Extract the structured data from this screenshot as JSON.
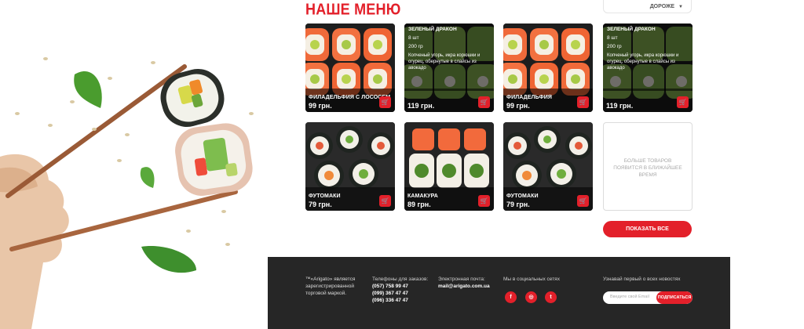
{
  "section_title": "НАШЕ МЕНЮ",
  "sort": {
    "selected": "ДОРОЖЕ",
    "icon": "caret-down-icon"
  },
  "products": [
    {
      "name": "ФИЛАДЕЛЬФИЯ С ЛОСОСЕМ",
      "price": "99 грн.",
      "image": "salmon-roll"
    },
    {
      "name": "ЗЕЛЕНЫЙ ДРАКОН",
      "price": "119 грн.",
      "image": "green-dragon-roll",
      "details": {
        "count": "8 шт",
        "weight": "200 гр",
        "description": "Копченый угорь, икра корюшки и огурец, обернутые в слайсы из авокадо"
      }
    },
    {
      "name": "ФИЛАДЕЛЬФИЯ",
      "price": "99 грн.",
      "image": "salmon-roll"
    },
    {
      "name": "ЗЕЛЕНЫЙ ДРАКОН",
      "price": "119 грн.",
      "image": "green-dragon-roll",
      "details": {
        "count": "8 шт",
        "weight": "200 гр",
        "description": "Копченый угорь, икра корюшки и огурец, обернутые в слайсы из авокадо"
      }
    },
    {
      "name": "ФУТОМАКИ",
      "price": "79 грн.",
      "image": "futomaki-roll"
    },
    {
      "name": "КАМАКУРА",
      "price": "89 грн.",
      "image": "kamakura-roll"
    },
    {
      "name": "ФУТОМАКИ",
      "price": "79 грн.",
      "image": "futomaki-roll"
    }
  ],
  "coming_soon": "БОЛЬШЕ ТОВАРОВ ПОЯВИТСЯ В БЛИЖАЙШЕЕ ВРЕМЯ",
  "show_all": "ПОКАЗАТЬ ВСЕ",
  "footer": {
    "trademark": [
      "™«Arigato» является",
      "зарегистрированной",
      "торговой маркой."
    ],
    "phones_label": "Телефоны для заказов:",
    "phones": [
      "(057) 758 99 47",
      "(099) 367 47 47",
      "(096) 336 47 47"
    ],
    "email_label": "Электронная почта:",
    "email": "mail@arigato.com.ua",
    "social_label": "Мы в социальных сетях",
    "social": [
      {
        "icon": "facebook-icon",
        "glyph": "f"
      },
      {
        "icon": "instagram-icon",
        "glyph": "◎"
      },
      {
        "icon": "twitter-icon",
        "glyph": "t"
      }
    ],
    "news_label": "Узнавай первый о всех новостях",
    "email_placeholder": "Введите свой Email",
    "subscribe": "ПОДПИСАТЬСЯ"
  },
  "colors": {
    "accent": "#e3202a",
    "footer_bg": "#262626"
  }
}
